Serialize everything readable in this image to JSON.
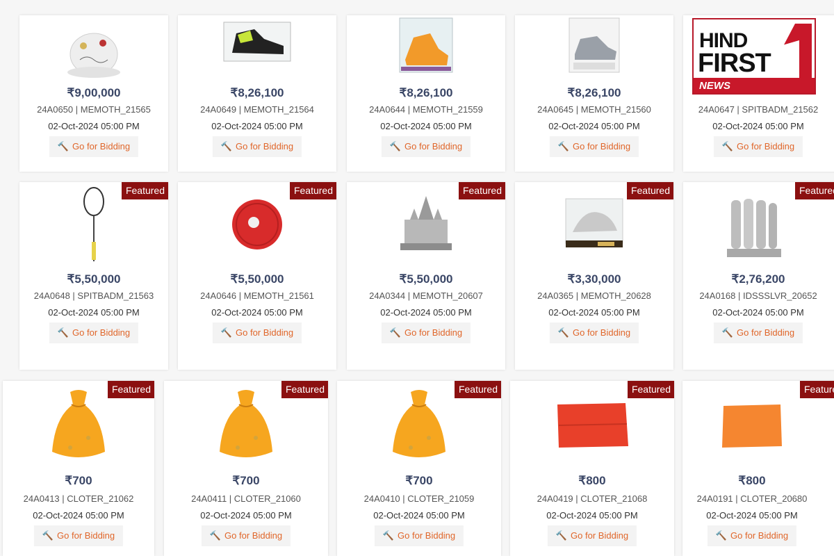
{
  "bid_label": "Go for Bidding",
  "featured_label": "Featured",
  "logo": {
    "line1": "HIND",
    "line2": "FIRST",
    "line3": "NEWS"
  },
  "row1": [
    {
      "price": "₹9,00,000",
      "code": "24A0650 | MEMOTH_21565",
      "date": "02-Oct-2024 05:00 PM",
      "image": "signed-cap"
    },
    {
      "price": "₹8,26,100",
      "code": "24A0649 | MEMOTH_21564",
      "date": "02-Oct-2024 05:00 PM",
      "image": "spikes-shoe"
    },
    {
      "price": "₹8,26,100",
      "code": "24A0644 | MEMOTH_21559",
      "date": "02-Oct-2024 05:00 PM",
      "image": "orange-shoe"
    },
    {
      "price": "₹8,26,100",
      "code": "24A0645 | MEMOTH_21560",
      "date": "02-Oct-2024 05:00 PM",
      "image": "grey-shoe"
    },
    {
      "price": "",
      "code": "24A0647 | SPITBADM_21562",
      "date": "02-Oct-2024 05:00 PM",
      "image": "hidden-by-logo"
    }
  ],
  "row2": [
    {
      "price": "₹5,50,000",
      "code": "24A0648 | SPITBADM_21563",
      "date": "02-Oct-2024 05:00 PM",
      "image": "badminton-racket"
    },
    {
      "price": "₹5,50,000",
      "code": "24A0646 | MEMOTH_21561",
      "date": "02-Oct-2024 05:00 PM",
      "image": "discus"
    },
    {
      "price": "₹5,50,000",
      "code": "24A0344 | MEMOTH_20607",
      "date": "02-Oct-2024 05:00 PM",
      "image": "temple-model"
    },
    {
      "price": "₹3,30,000",
      "code": "24A0365 | MEMOTH_20628",
      "date": "02-Oct-2024 05:00 PM",
      "image": "peacock-memento"
    },
    {
      "price": "₹2,76,200",
      "code": "24A0168 | IDSSSLVR_20652",
      "date": "02-Oct-2024 05:00 PM",
      "image": "silver-idols"
    }
  ],
  "row3": [
    {
      "price": "₹700",
      "code": "24A0413 | CLOTER_21062",
      "date": "02-Oct-2024 05:00 PM",
      "image": "orange-pouch"
    },
    {
      "price": "₹700",
      "code": "24A0411 | CLOTER_21060",
      "date": "02-Oct-2024 05:00 PM",
      "image": "orange-pouch"
    },
    {
      "price": "₹700",
      "code": "24A0410 | CLOTER_21059",
      "date": "02-Oct-2024 05:00 PM",
      "image": "orange-pouch"
    },
    {
      "price": "₹800",
      "code": "24A0419 | CLOTER_21068",
      "date": "02-Oct-2024 05:00 PM",
      "image": "red-cloth"
    },
    {
      "price": "₹800",
      "code": "24A0191 | CLOTER_20680",
      "date": "02-Oct-2024 05:00 PM",
      "image": "orange-cloth"
    }
  ]
}
